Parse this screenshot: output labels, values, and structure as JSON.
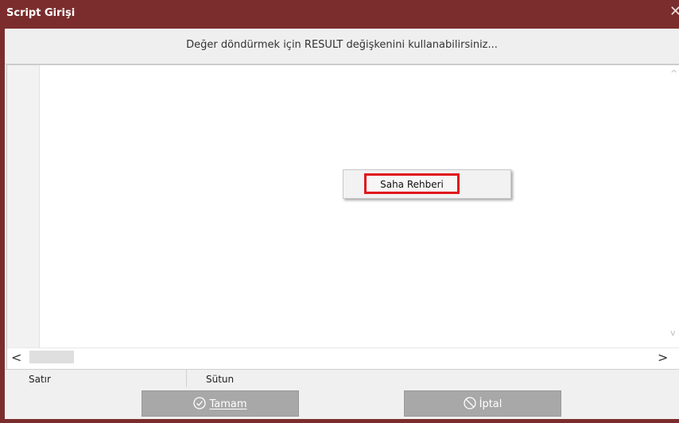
{
  "window": {
    "title": "Script Girişi",
    "close_glyph": "✕"
  },
  "hint": {
    "text": "Değer döndürmek için RESULT değişkenini kullanabilirsiniz..."
  },
  "editor": {
    "content": ""
  },
  "context_menu": {
    "items": [
      {
        "label": "Saha Rehberi",
        "highlighted": true
      }
    ]
  },
  "status": {
    "row_label": "Satır",
    "column_label": "Sütun"
  },
  "buttons": {
    "ok": {
      "label": "Tamam",
      "icon": "check-circle-icon"
    },
    "cancel": {
      "label": "İptal",
      "icon": "no-entry-icon"
    }
  },
  "scrollbars": {
    "left_arrow": "<",
    "right_arrow": ">",
    "up_arrow": "^",
    "down_arrow": "v"
  },
  "colors": {
    "titlebar": "#7b2d2d",
    "highlight_border": "#e0161b",
    "button_bg": "#a8a8a8"
  }
}
